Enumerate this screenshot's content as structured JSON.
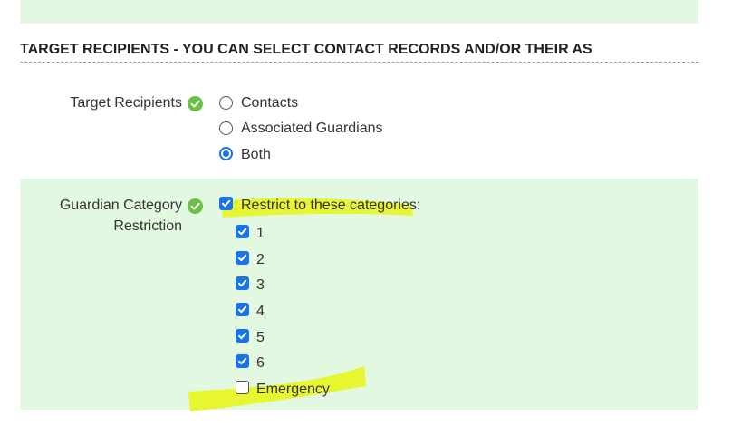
{
  "section": {
    "title": "TARGET RECIPIENTS - YOU CAN SELECT CONTACT RECORDS AND/OR THEIR AS"
  },
  "target_recipients": {
    "label": "Target Recipients",
    "options": [
      {
        "label": "Contacts",
        "selected": false
      },
      {
        "label": "Associated Guardians",
        "selected": false
      },
      {
        "label": "Both",
        "selected": true
      }
    ]
  },
  "guardian_category": {
    "label_line1": "Guardian Category",
    "label_line2": "Restriction",
    "restrict": {
      "label": "Restrict to these categories:",
      "checked": true
    },
    "categories": [
      {
        "label": "1",
        "checked": true
      },
      {
        "label": "2",
        "checked": true
      },
      {
        "label": "3",
        "checked": true
      },
      {
        "label": "4",
        "checked": true
      },
      {
        "label": "5",
        "checked": true
      },
      {
        "label": "6",
        "checked": true
      },
      {
        "label": "Emergency",
        "checked": false
      }
    ]
  },
  "icons": {
    "help": "check-circle-icon"
  },
  "colors": {
    "panel_bg": "#e2f8e0",
    "accent": "#1a73e8",
    "ok_icon": "#6cbf47",
    "highlighter": "#e9f51f"
  }
}
